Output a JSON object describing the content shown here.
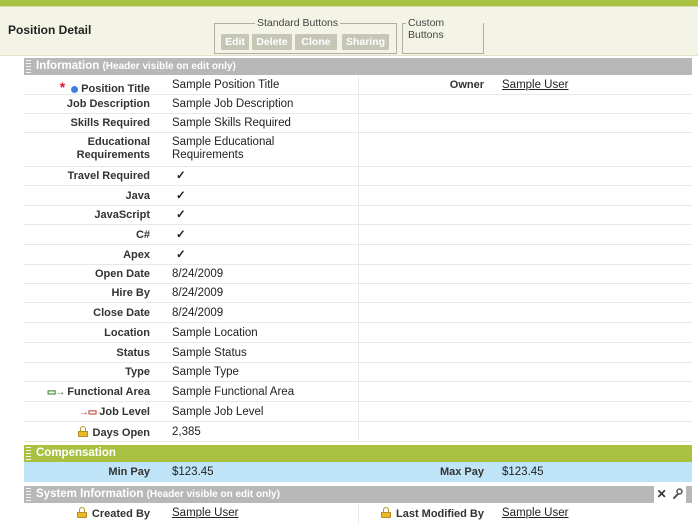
{
  "header": {
    "title": "Position Detail",
    "standard_buttons_legend": "Standard Buttons",
    "custom_buttons_legend": "Custom Buttons",
    "buttons": [
      "Edit",
      "Delete",
      "Clone",
      "Sharing"
    ]
  },
  "sections": {
    "information": {
      "title": "Information",
      "note": "(Header visible on edit only)"
    },
    "compensation": {
      "title": "Compensation"
    },
    "system": {
      "title": "System Information",
      "note": "(Header visible on edit only)"
    }
  },
  "fields": {
    "position_title": {
      "label": "Position Title",
      "value": "Sample Position Title"
    },
    "owner": {
      "label": "Owner",
      "value": "Sample User"
    },
    "job_description": {
      "label": "Job Description",
      "value": "Sample Job Description"
    },
    "skills_required": {
      "label": "Skills Required",
      "value": "Sample Skills Required"
    },
    "educational_requirements": {
      "label_line1": "Educational",
      "label_line2": "Requirements",
      "value_line1": "Sample Educational",
      "value_line2": "Requirements"
    },
    "travel_required": {
      "label": "Travel Required",
      "value": "✓"
    },
    "java": {
      "label": "Java",
      "value": "✓"
    },
    "javascript": {
      "label": "JavaScript",
      "value": "✓"
    },
    "csharp": {
      "label": "C#",
      "value": "✓"
    },
    "apex": {
      "label": "Apex",
      "value": "✓"
    },
    "open_date": {
      "label": "Open Date",
      "value": "8/24/2009"
    },
    "hire_by": {
      "label": "Hire By",
      "value": "8/24/2009"
    },
    "close_date": {
      "label": "Close Date",
      "value": "8/24/2009"
    },
    "location": {
      "label": "Location",
      "value": "Sample Location"
    },
    "status": {
      "label": "Status",
      "value": "Sample Status"
    },
    "type": {
      "label": "Type",
      "value": "Sample Type"
    },
    "functional_area": {
      "label": "Functional Area",
      "value": "Sample Functional Area"
    },
    "job_level": {
      "label": "Job Level",
      "value": "Sample Job Level"
    },
    "days_open": {
      "label": "Days Open",
      "value": "2,385"
    },
    "min_pay": {
      "label": "Min Pay",
      "value": "$123.45"
    },
    "max_pay": {
      "label": "Max Pay",
      "value": "$123.45"
    },
    "created_by": {
      "label": "Created By",
      "value": "Sample User"
    },
    "last_modified_by": {
      "label": "Last Modified By",
      "value": "Sample User"
    }
  },
  "icons": {
    "required": "*",
    "close": "✕",
    "wrench": "wrench-icon"
  },
  "colors": {
    "accent_green": "#a9c140",
    "section_gray": "#b8b8b8",
    "compensation_row": "#bfe4f7",
    "required_red": "#e0162b",
    "info_dot": "#3d7fe0"
  }
}
